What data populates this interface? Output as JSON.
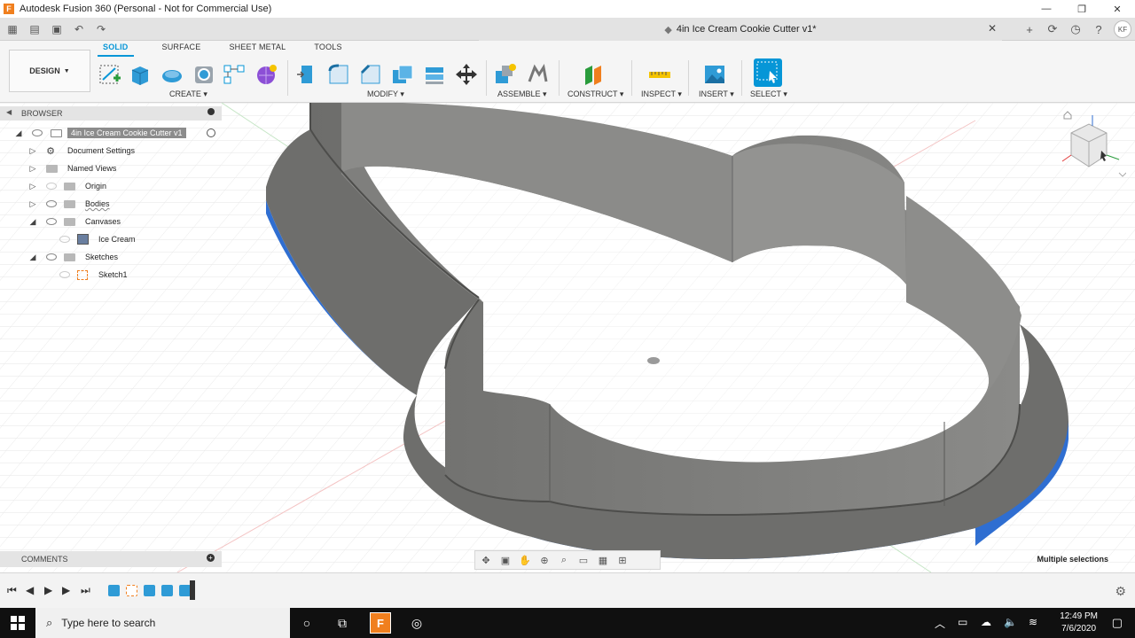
{
  "window": {
    "title": "Autodesk Fusion 360 (Personal - Not for Commercial Use)",
    "app_icon": "F",
    "minimize": "—",
    "restore": "❐",
    "close": "✕"
  },
  "document": {
    "title": "4in Ice Cream Cookie Cutter v1*"
  },
  "user": {
    "initials": "KF"
  },
  "workspace": {
    "label": "DESIGN"
  },
  "ribbon": {
    "tabs": [
      "SOLID",
      "SURFACE",
      "SHEET METAL",
      "TOOLS"
    ],
    "active_tab": "SOLID",
    "groups": [
      "CREATE",
      "MODIFY",
      "ASSEMBLE",
      "CONSTRUCT",
      "INSPECT",
      "INSERT",
      "SELECT"
    ]
  },
  "browser": {
    "title": "BROWSER",
    "items": [
      {
        "label": "4in Ice Cream Cookie Cutter v1"
      },
      {
        "label": "Document Settings"
      },
      {
        "label": "Named Views"
      },
      {
        "label": "Origin"
      },
      {
        "label": "Bodies"
      },
      {
        "label": "Canvases"
      },
      {
        "label": "Ice Cream"
      },
      {
        "label": "Sketches"
      },
      {
        "label": "Sketch1"
      }
    ]
  },
  "comments": {
    "title": "COMMENTS"
  },
  "status": {
    "selection": "Multiple selections"
  },
  "taskbar": {
    "search_placeholder": "Type here to search",
    "time": "12:49 PM",
    "date": "7/6/2020"
  },
  "colors": {
    "accent": "#0696d7",
    "body_gray": "#7a7a78",
    "selected_face": "#2f6ed1"
  }
}
